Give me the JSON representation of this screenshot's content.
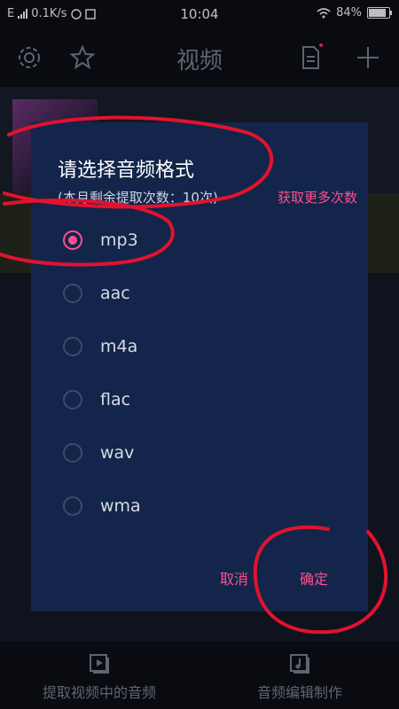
{
  "status_bar": {
    "network": "E",
    "speed": "0.1K/s",
    "time": "10:04",
    "battery": "84%"
  },
  "topbar": {
    "title": "视频"
  },
  "bottom_nav": [
    {
      "label": "提取视频中的音频",
      "icon": "video-play-icon"
    },
    {
      "label": "音频编辑制作",
      "icon": "music-note-icon"
    }
  ],
  "dialog": {
    "title": "请选择音频格式",
    "quota": "(本月剩余提取次数：10次)",
    "more_link": "获取更多次数",
    "options": [
      {
        "label": "mp3",
        "selected": true
      },
      {
        "label": "aac",
        "selected": false
      },
      {
        "label": "m4a",
        "selected": false
      },
      {
        "label": "flac",
        "selected": false
      },
      {
        "label": "wav",
        "selected": false
      },
      {
        "label": "wma",
        "selected": false
      }
    ],
    "cancel_label": "取消",
    "confirm_label": "确定"
  },
  "colors": {
    "accent": "#ff4f90",
    "dialog_bg": "#13254a",
    "annotation": "#e1132f"
  }
}
